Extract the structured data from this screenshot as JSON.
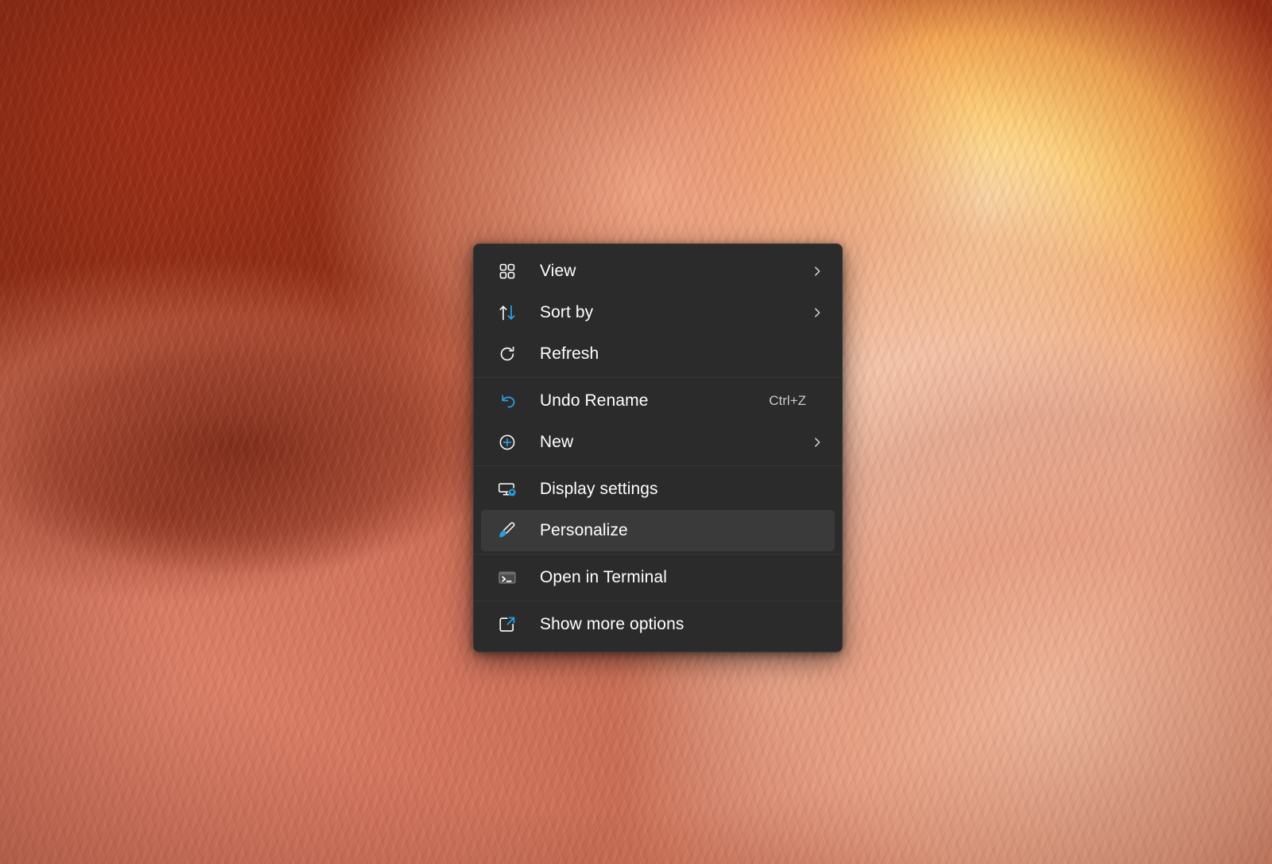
{
  "wallpaper": {
    "name": "antelope-slot-canyon-wallpaper",
    "description": "Slot canyon sandstone walls in red, orange and cream tones",
    "colors": {
      "deep_red": "#9e2f15",
      "rust": "#c04426",
      "golden_glow": "#ffd07a",
      "pale_sand": "#fbd6c0",
      "salmon": "#d5755e"
    }
  },
  "context_menu": {
    "name": "desktop-context-menu",
    "background": "#2b2b2b",
    "selected_background": "#3a3a3a",
    "text_color": "#ffffff",
    "accent_color": "#2a9ce0",
    "sections": [
      {
        "items": [
          {
            "label": "View",
            "icon": "grid-view-icon",
            "submenu": true,
            "accelerator": "",
            "selected": false
          },
          {
            "label": "Sort by",
            "icon": "sort-arrows-icon",
            "submenu": true,
            "accelerator": "",
            "selected": false
          },
          {
            "label": "Refresh",
            "icon": "refresh-icon",
            "submenu": false,
            "accelerator": "",
            "selected": false
          }
        ]
      },
      {
        "items": [
          {
            "label": "Undo Rename",
            "icon": "undo-icon",
            "submenu": false,
            "accelerator": "Ctrl+Z",
            "selected": false
          },
          {
            "label": "New",
            "icon": "plus-circle-icon",
            "submenu": true,
            "accelerator": "",
            "selected": false
          }
        ]
      },
      {
        "items": [
          {
            "label": "Display settings",
            "icon": "monitor-gear-icon",
            "submenu": false,
            "accelerator": "",
            "selected": false
          },
          {
            "label": "Personalize",
            "icon": "paintbrush-icon",
            "submenu": false,
            "accelerator": "",
            "selected": true
          }
        ]
      },
      {
        "items": [
          {
            "label": "Open in Terminal",
            "icon": "terminal-icon",
            "submenu": false,
            "accelerator": "",
            "selected": false
          }
        ]
      },
      {
        "items": [
          {
            "label": "Show more options",
            "icon": "show-more-options-icon",
            "submenu": false,
            "accelerator": "",
            "selected": false
          }
        ]
      }
    ]
  }
}
